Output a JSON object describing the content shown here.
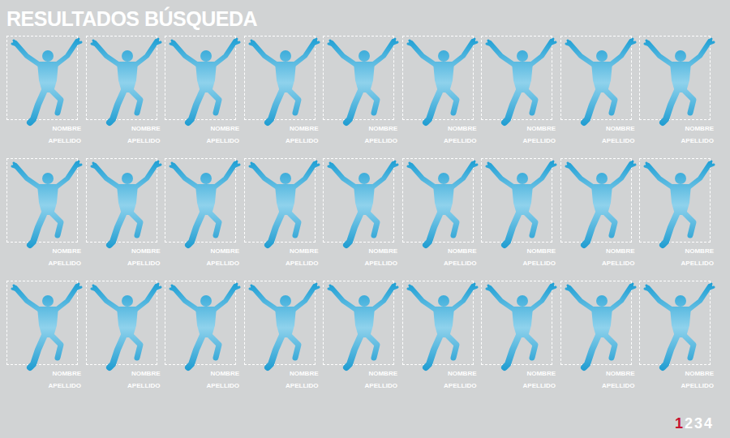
{
  "title": "RESULTADOS BÚSQUEDA",
  "results": [
    {
      "name": "NOMBRE",
      "surname": "APELLIDO"
    },
    {
      "name": "NOMBRE",
      "surname": "APELLIDO"
    },
    {
      "name": "NOMBRE",
      "surname": "APELLIDO"
    },
    {
      "name": "NOMBRE",
      "surname": "APELLIDO"
    },
    {
      "name": "NOMBRE",
      "surname": "APELLIDO"
    },
    {
      "name": "NOMBRE",
      "surname": "APELLIDO"
    },
    {
      "name": "NOMBRE",
      "surname": "APELLIDO"
    },
    {
      "name": "NOMBRE",
      "surname": "APELLIDO"
    },
    {
      "name": "NOMBRE",
      "surname": "APELLIDO"
    },
    {
      "name": "NOMBRE",
      "surname": "APELLIDO"
    },
    {
      "name": "NOMBRE",
      "surname": "APELLIDO"
    },
    {
      "name": "NOMBRE",
      "surname": "APELLIDO"
    },
    {
      "name": "NOMBRE",
      "surname": "APELLIDO"
    },
    {
      "name": "NOMBRE",
      "surname": "APELLIDO"
    },
    {
      "name": "NOMBRE",
      "surname": "APELLIDO"
    },
    {
      "name": "NOMBRE",
      "surname": "APELLIDO"
    },
    {
      "name": "NOMBRE",
      "surname": "APELLIDO"
    },
    {
      "name": "NOMBRE",
      "surname": "APELLIDO"
    },
    {
      "name": "NOMBRE",
      "surname": "APELLIDO"
    },
    {
      "name": "NOMBRE",
      "surname": "APELLIDO"
    },
    {
      "name": "NOMBRE",
      "surname": "APELLIDO"
    },
    {
      "name": "NOMBRE",
      "surname": "APELLIDO"
    },
    {
      "name": "NOMBRE",
      "surname": "APELLIDO"
    },
    {
      "name": "NOMBRE",
      "surname": "APELLIDO"
    },
    {
      "name": "NOMBRE",
      "surname": "APELLIDO"
    },
    {
      "name": "NOMBRE",
      "surname": "APELLIDO"
    },
    {
      "name": "NOMBRE",
      "surname": "APELLIDO"
    }
  ],
  "pagination": [
    {
      "label": "1",
      "selected": true
    },
    {
      "label": "2",
      "selected": false
    },
    {
      "label": "3",
      "selected": false
    },
    {
      "label": "4",
      "selected": false
    }
  ]
}
